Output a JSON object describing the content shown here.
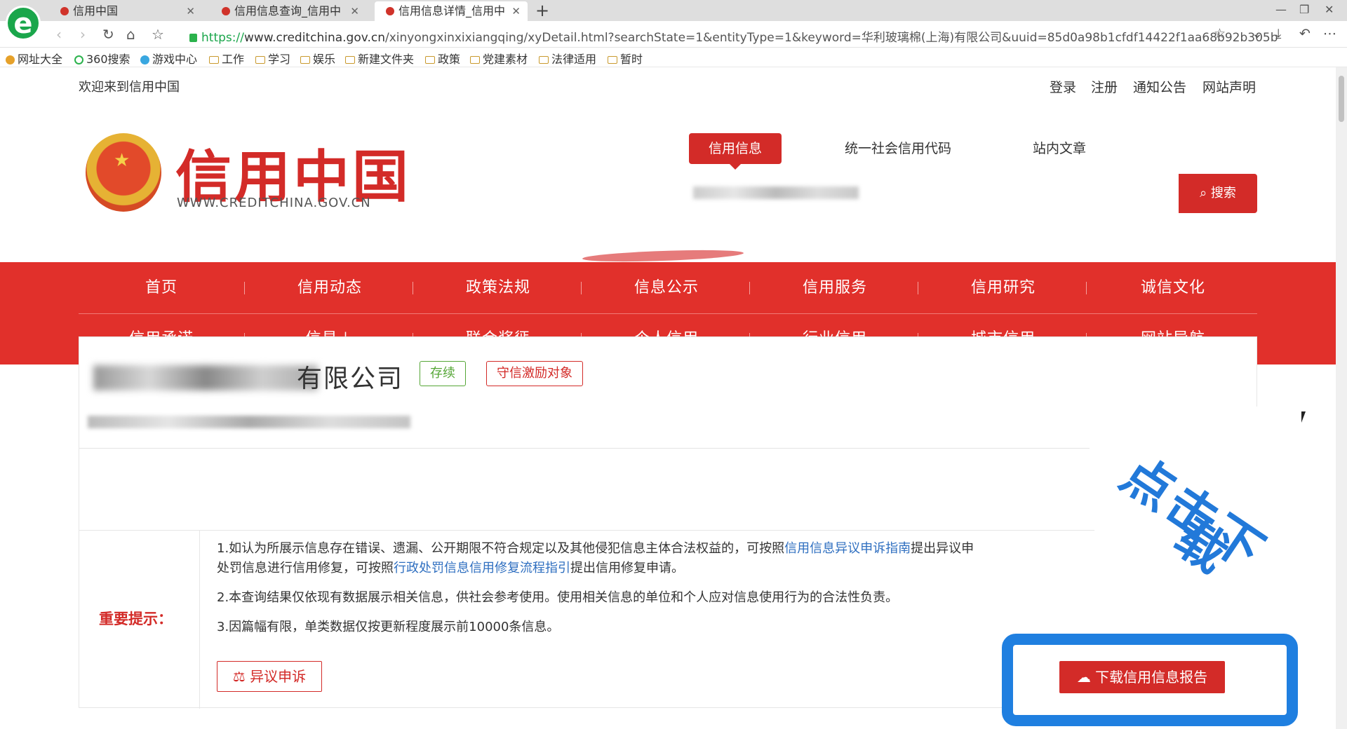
{
  "browser": {
    "tabs": [
      {
        "title": "信用中国"
      },
      {
        "title": "信用信息查询_信用中"
      },
      {
        "title": "信用信息详情_信用中"
      }
    ],
    "url_scheme": "https://",
    "url_host": "www.creditchina.gov.cn",
    "url_path": "/xinyongxinxixiangqing/xyDetail.html?searchState=1&entityType=1&keyword=华利玻璃棉(上海)有限公司&uuid=85d0a98b1cfdf14422f1aa68b92b305b",
    "bookmarks": [
      "网址大全",
      "360搜索",
      "游戏中心",
      "工作",
      "学习",
      "娱乐",
      "新建文件夹",
      "政策",
      "党建素材",
      "法律适用",
      "暂时"
    ]
  },
  "page": {
    "welcome": "欢迎来到信用中国",
    "top_links": [
      "登录",
      "注册",
      "通知公告",
      "网站声明"
    ],
    "logo_cn": "信用中国",
    "logo_en": "WWW.CREDITCHINA.GOV.CN",
    "search_tabs": [
      "信用信息",
      "统一社会信用代码",
      "站内文章"
    ],
    "search_button": "搜索",
    "nav_row1": [
      "首页",
      "信用动态",
      "政策法规",
      "信息公示",
      "信用服务",
      "信用研究",
      "诚信文化"
    ],
    "nav_row2": [
      "信用承诺",
      "信易＋",
      "联合奖惩",
      "个人信用",
      "行业信用",
      "城市信用",
      "网站导航"
    ],
    "company": {
      "name_visible": "有限公司",
      "status_badge": "存续",
      "honor_badge": "守信激励对象"
    },
    "notice": {
      "label": "重要提示：",
      "line1_a": "1.如认为所展示信息存在错误、遗漏、公开期限不符合规定以及其他侵犯信息主体合法权益的，可按照",
      "line1_link": "信用信息异议申诉指南",
      "line1_b": "提出异议申",
      "line1c_a": "处罚信息进行信用修复，可按照",
      "line1c_link": "行政处罚信息信用修复流程指引",
      "line1c_b": "提出信用修复申请。",
      "line2": "2.本查询结果仅依现有数据展示相关信息，供社会参考使用。使用相关信息的单位和个人应对信息使用行为的合法性负责。",
      "line3": "3.因篇幅有限，单类数据仅按更新程度展示前10000条信息。",
      "appeal_button": "异议申诉"
    },
    "overlay": {
      "text_line1": "点击下",
      "text_line2": "载",
      "download_button": "下载信用信息报告"
    }
  },
  "colors": {
    "brand_red": "#d32b28",
    "nav_red": "#e1302b",
    "link_blue": "#2f6fc0",
    "overlay_blue": "#1f7fe0",
    "status_green": "#55a636"
  }
}
